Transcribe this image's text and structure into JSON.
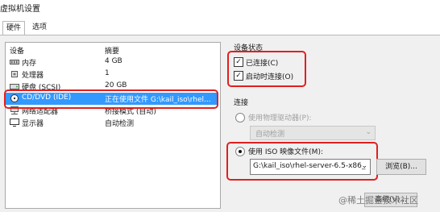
{
  "window": {
    "title": "虚拟机设置"
  },
  "tabs": [
    {
      "label": "硬件"
    },
    {
      "label": "选项"
    }
  ],
  "device_list": {
    "headers": {
      "device": "设备",
      "summary": "摘要"
    },
    "rows": [
      {
        "device": "内存",
        "summary": "4 GB",
        "icon": "memory-icon"
      },
      {
        "device": "处理器",
        "summary": "1",
        "icon": "cpu-icon"
      },
      {
        "device": "硬盘 (SCSI)",
        "summary": "20 GB",
        "icon": "harddisk-icon"
      },
      {
        "device": "CD/DVD (IDE)",
        "summary": "正在使用文件 G:\\kail_iso\\rhel...",
        "icon": "cdrom-icon"
      },
      {
        "device": "网络适配器",
        "summary": "桥接模式 (自动)",
        "icon": "network-icon"
      },
      {
        "device": "显示器",
        "summary": "自动检测",
        "icon": "monitor-icon"
      }
    ]
  },
  "device_status": {
    "title": "设备状态",
    "connected": {
      "label": "已连接(C)",
      "checked": true
    },
    "connect_on_power": {
      "label": "启动时连接(O)",
      "checked": true
    }
  },
  "connection": {
    "title": "连接",
    "physical_drive": {
      "label": "使用物理驱动器(P):",
      "selected": false
    },
    "physical_drive_value": "自动检测",
    "iso_image": {
      "label": "使用 ISO 映像文件(M):",
      "selected": true
    },
    "iso_path": "G:\\kail_iso\\rhel-server-6.5-x86_",
    "browse_label": "浏览(B)...",
    "advanced_label": "高级(V)..."
  },
  "watermark": "@稀土掘金技术社区",
  "colors": {
    "selection": "#3399ff",
    "highlight": "#e0201e"
  }
}
